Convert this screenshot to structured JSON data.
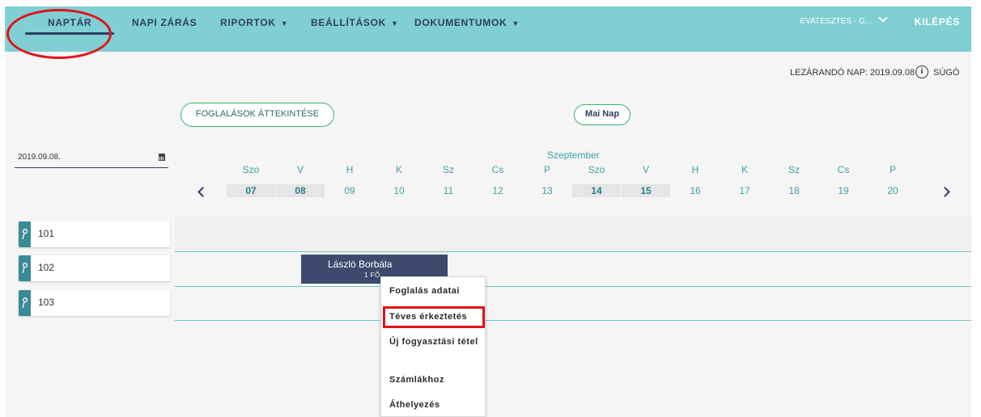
{
  "nav": {
    "items": [
      {
        "label": "NAPTÁR",
        "active": true
      },
      {
        "label": "NAPI ZÁRÁS",
        "dropdown": false
      },
      {
        "label": "RIPORTOK",
        "dropdown": true
      },
      {
        "label": "BEÁLLÍTÁSOK",
        "dropdown": true
      },
      {
        "label": "DOKUMENTUMOK",
        "dropdown": true
      }
    ],
    "user": "EVATESZTES - G...",
    "logout": "KILÉPÉS"
  },
  "header": {
    "lezarando": "LEZÁRANDÓ NAP: 2019.09.08",
    "help": "SÚGÓ"
  },
  "buttons": {
    "overview": "FOGLALÁSOK ÁTTEKINTÉSE",
    "today": "Mai Nap"
  },
  "date_input": {
    "value": "2019.09.08."
  },
  "calendar": {
    "month": "Szeptember",
    "days": [
      {
        "name": "Szo",
        "num": "07",
        "highlight": true
      },
      {
        "name": "V",
        "num": "08",
        "highlight": true
      },
      {
        "name": "H",
        "num": "09",
        "highlight": false
      },
      {
        "name": "K",
        "num": "10",
        "highlight": false
      },
      {
        "name": "Sz",
        "num": "11",
        "highlight": false
      },
      {
        "name": "Cs",
        "num": "12",
        "highlight": false
      },
      {
        "name": "P",
        "num": "13",
        "highlight": false
      },
      {
        "name": "Szo",
        "num": "14",
        "highlight": true
      },
      {
        "name": "V",
        "num": "15",
        "highlight": true
      },
      {
        "name": "H",
        "num": "16",
        "highlight": false
      },
      {
        "name": "K",
        "num": "17",
        "highlight": false
      },
      {
        "name": "Sz",
        "num": "18",
        "highlight": false
      },
      {
        "name": "Cs",
        "num": "19",
        "highlight": false
      },
      {
        "name": "P",
        "num": "20",
        "highlight": false
      }
    ]
  },
  "rooms": [
    {
      "number": "101"
    },
    {
      "number": "102"
    },
    {
      "number": "103"
    }
  ],
  "booking": {
    "guest": "László Borbála",
    "persons": "1 FŐ"
  },
  "context_menu": {
    "items": [
      "Foglalás adatai",
      "Téves érkeztetés",
      "Új fogyasztási tétel",
      "Számlákhoz",
      "Áthelyezés"
    ]
  },
  "colors": {
    "topbar": "#80cfd2",
    "navy": "#2e3f63",
    "teal": "#3a9fa8",
    "green": "#3bb272",
    "annotation_red": "#e0121b"
  },
  "icons": [
    "calendar-icon",
    "info-icon",
    "key-icon",
    "chevron-left-icon",
    "chevron-right-icon",
    "chevron-down-icon"
  ]
}
